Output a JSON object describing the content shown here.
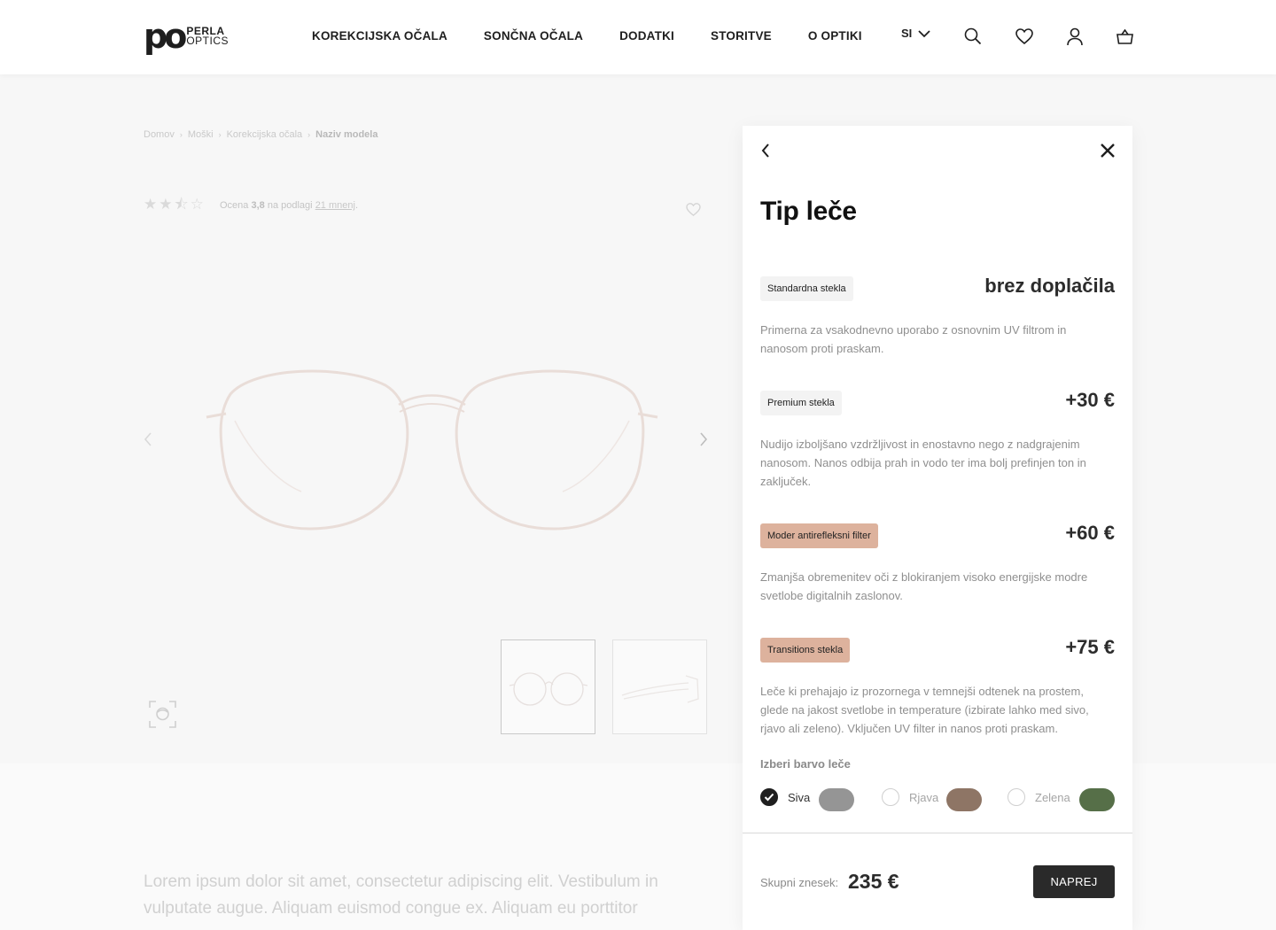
{
  "header": {
    "logo_mark": "po",
    "logo_line1": "PERLA",
    "logo_line2": "OPTICS",
    "nav": [
      "KOREKCIJSKA OČALA",
      "SONČNA OČALA",
      "DODATKI",
      "STORITVE",
      "O OPTIKI"
    ],
    "language": "SI"
  },
  "background": {
    "breadcrumb": [
      "Domov",
      "Moški",
      "Korekcijska očala",
      "Naziv modela"
    ],
    "rating_stars": 3.8,
    "rating_prefix": "Ocena",
    "rating_value": "3,8",
    "rating_mid": "na podlagi",
    "rating_link": "21 mnenj",
    "rating_suffix": ".",
    "lorem": "Lorem ipsum dolor sit amet, consectetur adipiscing elit. Vestibulum in vulputate augue. Aliquam euismod congue ex. Aliquam eu porttitor"
  },
  "panel": {
    "title": "Tip leče",
    "options": [
      {
        "tag": "Standardna stekla",
        "price": "brez doplačila",
        "description": "Primerna za vsakodnevno uporabo z osnovnim UV filtrom in nanosom proti praskam."
      },
      {
        "tag": "Premium stekla",
        "price": "+30 €",
        "description": "Nudijo izboljšano vzdržljivost in enostavno nego z nadgrajenim nanosom. Nanos odbija prah in vodo ter ima bolj prefinjen ton in zaključek."
      },
      {
        "tag": "Moder antirefleksni filter",
        "price": "+60 €",
        "description": "Zmanjša obremenitev oči z blokiranjem visoko energijske modre svetlobe digitalnih zaslonov."
      },
      {
        "tag": "Transitions stekla",
        "price": "+75 €",
        "description": "Leče ki prehajajo iz prozornega v temnejši odtenek na prostem, glede na jakost svetlobe in temperature (izbirate lahko med sivo, rjavo ali zeleno). Vključen UV filter in nanos proti praskam."
      }
    ],
    "color_heading": "Izberi barvo leče",
    "colors": [
      {
        "label": "Siva",
        "hex": "#959595",
        "selected": true
      },
      {
        "label": "Rjava",
        "hex": "#8e7565",
        "selected": false
      },
      {
        "label": "Zelena",
        "hex": "#566f48",
        "selected": false
      }
    ],
    "total_label": "Skupni znesek:",
    "total_value": "235 €",
    "next_button": "NAPREJ"
  },
  "theme": {
    "accent_tag": "#ddb29d",
    "button_bg": "#2a2a2a"
  },
  "icons": [
    "chevron-down-icon",
    "search-icon",
    "heart-icon",
    "user-icon",
    "cart-icon",
    "back-arrow-icon",
    "close-icon",
    "chevron-left-icon",
    "chevron-right-icon",
    "face-scan-icon"
  ]
}
